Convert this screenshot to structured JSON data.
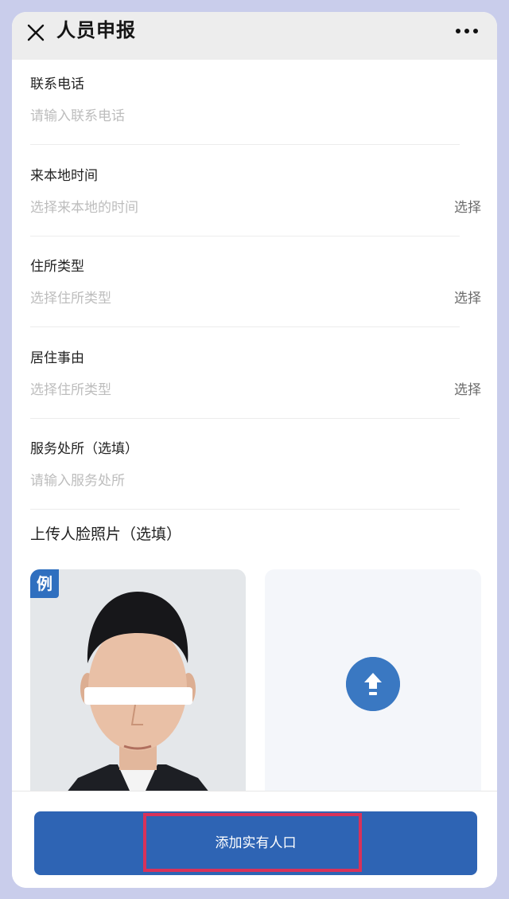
{
  "header": {
    "title": "人员申报",
    "close_icon": "close-icon",
    "more_icon": "more-icon"
  },
  "form": {
    "fields": [
      {
        "label": "联系电话",
        "placeholder": "请输入联系电话",
        "action": ""
      },
      {
        "label": "来本地时间",
        "placeholder": "选择来本地的时间",
        "action": "选择"
      },
      {
        "label": "住所类型",
        "placeholder": "选择住所类型",
        "action": "选择"
      },
      {
        "label": "居住事由",
        "placeholder": "选择住所类型",
        "action": "选择"
      },
      {
        "label": "服务处所（选填）",
        "placeholder": "请输入服务处所",
        "action": ""
      }
    ],
    "photo_section_title": "上传人脸照片（选填）",
    "example_badge": "例",
    "upload_icon": "upload-arrow-icon"
  },
  "footer": {
    "submit_label": "添加实有人口",
    "accent": "#2e64b4",
    "highlight": "#d8325a"
  }
}
